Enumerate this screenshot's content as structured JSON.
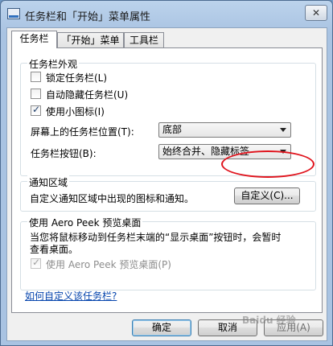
{
  "window": {
    "title": "任务栏和「开始」菜单属性",
    "close_label": "✕"
  },
  "tabs": [
    {
      "label": "任务栏",
      "active": true
    },
    {
      "label": "「开始」菜单",
      "active": false
    },
    {
      "label": "工具栏",
      "active": false
    }
  ],
  "appearance": {
    "legend": "任务栏外观",
    "lock": {
      "label": "锁定任务栏(L)",
      "checked": false
    },
    "autohide": {
      "label": "自动隐藏任务栏(U)",
      "checked": false
    },
    "small_icons": {
      "label": "使用小图标(I)",
      "checked": true
    },
    "position": {
      "label": "屏幕上的任务栏位置(T):",
      "value": "底部"
    },
    "buttons": {
      "label": "任务栏按钮(B):",
      "value": "始终合并、隐藏标签"
    }
  },
  "notify": {
    "legend": "通知区域",
    "text": "自定义通知区域中出现的图标和通知。",
    "customize_button": "自定义(C)..."
  },
  "aeropeek": {
    "legend": "使用 Aero Peek 预览桌面",
    "desc_line1": "当您将鼠标移动到任务栏末端的“显示桌面”按钮时，会暂时",
    "desc_line2": "查看桌面。",
    "checkbox": {
      "label": "使用 Aero Peek 预览桌面(P)",
      "checked": true,
      "enabled": false
    }
  },
  "help_link": "如何自定义该任务栏?",
  "footer": {
    "ok": "确定",
    "cancel": "取消",
    "apply": "应用(A)"
  },
  "watermark": "Baidu 经验"
}
